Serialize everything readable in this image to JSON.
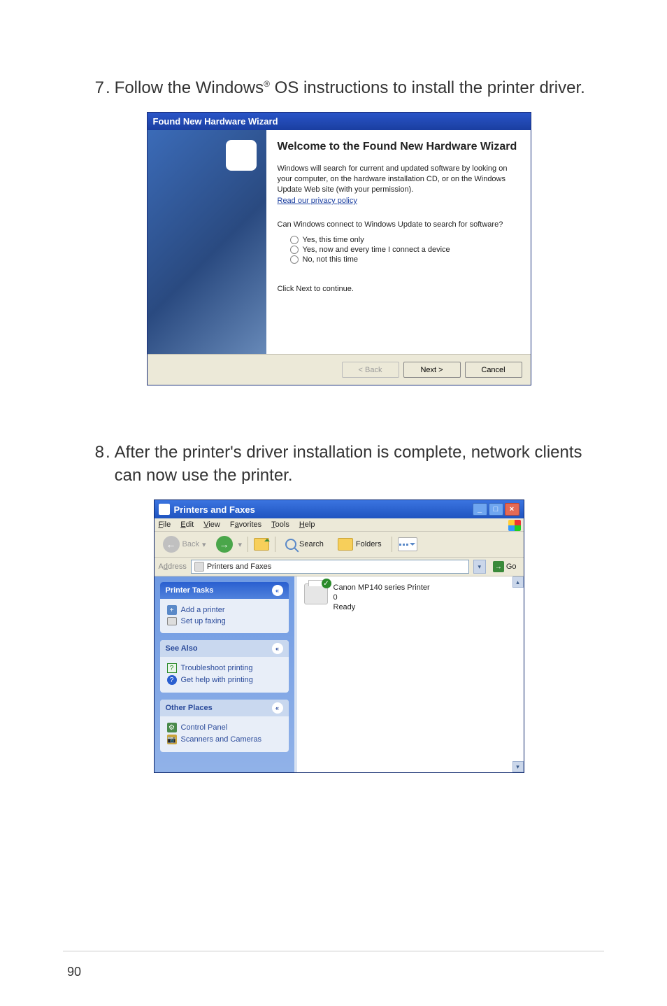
{
  "page": {
    "number": "90",
    "step7": {
      "num": "7",
      "text_pre": "Follow the Windows",
      "reg": "®",
      "text_post": " OS instructions to install the printer driver."
    },
    "step8": {
      "num": "8",
      "text": "After the printer's driver installation is complete, network clients can now use the printer."
    }
  },
  "wizard": {
    "title": "Found New Hardware Wizard",
    "heading": "Welcome to the Found New Hardware Wizard",
    "para": "Windows will search for current and updated software by looking on your computer, on the hardware installation CD, or on the Windows Update Web site (with your permission).",
    "privacy": "Read our privacy policy",
    "question": "Can Windows connect to Windows Update to search for software?",
    "opt1": "Yes, this time only",
    "opt2": "Yes, now and every time I connect a device",
    "opt3": "No, not this time",
    "click_next": "Click Next to continue.",
    "back": "< Back",
    "next": "Next >",
    "cancel": "Cancel"
  },
  "pf": {
    "title": "Printers and Faxes",
    "menu": {
      "file": "File",
      "edit": "Edit",
      "view": "View",
      "favorites": "Favorites",
      "tools": "Tools",
      "help": "Help"
    },
    "toolbar": {
      "back": "Back",
      "search": "Search",
      "folders": "Folders"
    },
    "address": {
      "label": "Address",
      "value": "Printers and Faxes",
      "go": "Go"
    },
    "side": {
      "tasks": {
        "title": "Printer Tasks",
        "add": "Add a printer",
        "fax": "Set up faxing"
      },
      "see": {
        "title": "See Also",
        "trouble": "Troubleshoot printing",
        "help": "Get help with printing"
      },
      "other": {
        "title": "Other Places",
        "cp": "Control Panel",
        "sc": "Scanners and Cameras"
      }
    },
    "printer": {
      "name": "Canon MP140 series Printer",
      "count": "0",
      "status": "Ready"
    }
  }
}
